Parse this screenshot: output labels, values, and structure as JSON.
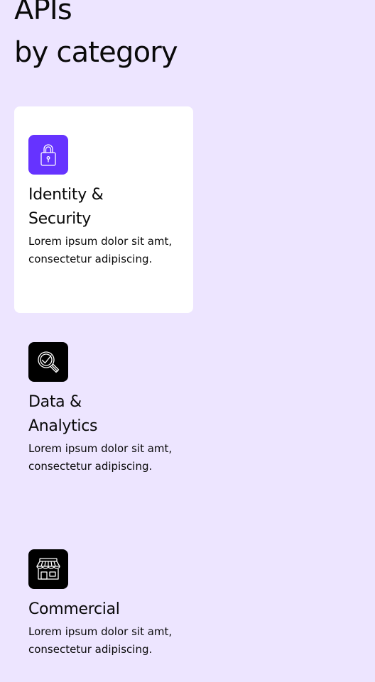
{
  "header": {
    "title_line1": "APIs",
    "title_line2": "by category"
  },
  "categories": [
    {
      "title": "Identity & Security",
      "description": "Lorem ipsum dolor sit amt, consectetur adipiscing.",
      "icon": "lock-icon",
      "icon_bg": "#6633ff",
      "selected": true
    },
    {
      "title": "Data & Analytics",
      "description": "Lorem ipsum dolor sit amt, consectetur adipiscing.",
      "icon": "magnifier-check-icon",
      "icon_bg": "#000000",
      "selected": false
    },
    {
      "title": "Commercial",
      "description": "Lorem ipsum dolor sit amt, consectetur adipiscing.",
      "icon": "storefront-icon",
      "icon_bg": "#000000",
      "selected": false
    }
  ],
  "colors": {
    "page_background": "#ede5ff",
    "card_background": "#ffffff",
    "accent": "#6633ff",
    "text": "#0a0a0a"
  }
}
